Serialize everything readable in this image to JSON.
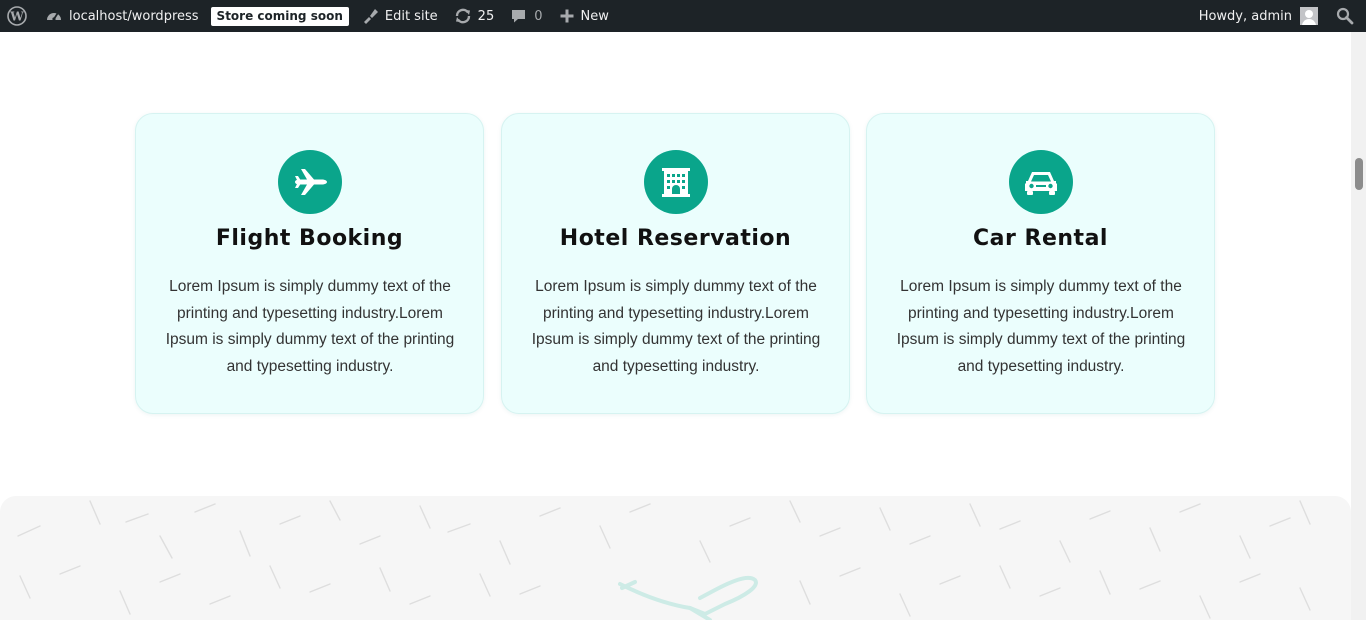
{
  "adminbar": {
    "site_name": "localhost/wordpress",
    "store_badge": "Store coming soon",
    "edit_site": "Edit site",
    "updates_count": "25",
    "comments_count": "0",
    "new_label": "New",
    "greeting": "Howdy, admin"
  },
  "services": [
    {
      "icon": "airplane-icon",
      "title": "Flight Booking",
      "text": "Lorem Ipsum is simply dummy text of the printing and typesetting industry.Lorem Ipsum is simply dummy text of the printing and typesetting industry."
    },
    {
      "icon": "hotel-building-icon",
      "title": "Hotel Reservation",
      "text": "Lorem Ipsum is simply dummy text of the printing and typesetting industry.Lorem Ipsum is simply dummy text of the printing and typesetting industry."
    },
    {
      "icon": "car-icon",
      "title": "Car Rental",
      "text": "Lorem Ipsum is simply dummy text of the printing and typesetting industry.Lorem Ipsum is simply dummy text of the printing and typesetting industry."
    }
  ],
  "colors": {
    "adminbar_bg": "#1d2327",
    "card_bg": "#ebfefd",
    "icon_accent": "#0aa58b",
    "banner_bg": "#f6f6f6"
  }
}
